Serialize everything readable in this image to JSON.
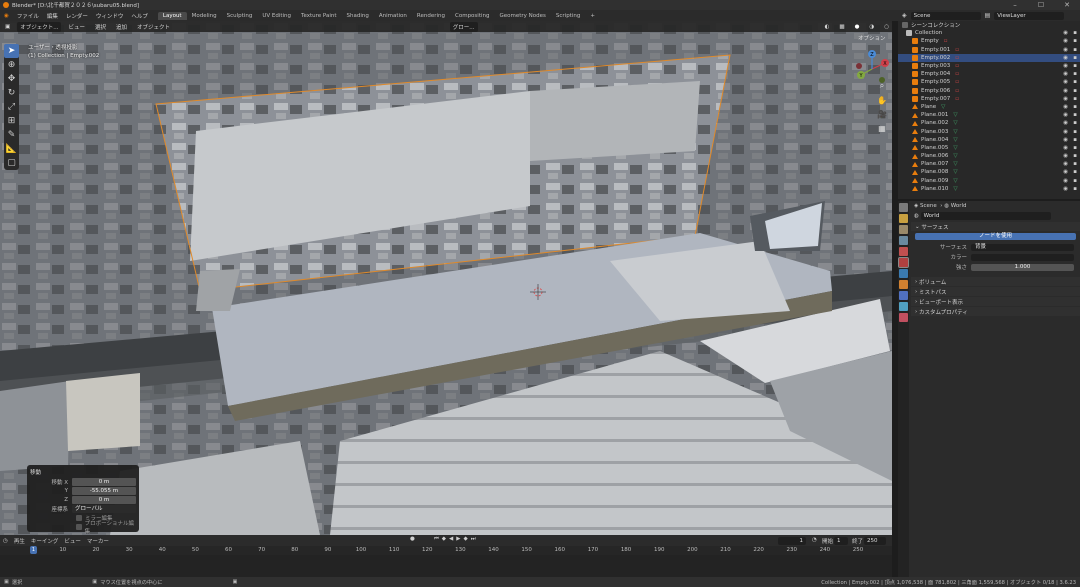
{
  "window": {
    "title": "Blender* [D:\\北千都賀２０２６\\subaru05.blend]"
  },
  "menu": [
    "ファイル",
    "編集",
    "レンダー",
    "ウィンドウ",
    "ヘルプ"
  ],
  "workspaces": [
    "Layout",
    "Modeling",
    "Sculpting",
    "UV Editing",
    "Texture Paint",
    "Shading",
    "Animation",
    "Rendering",
    "Compositing",
    "Geometry Nodes",
    "Scripting"
  ],
  "active_workspace": "Layout",
  "topright": {
    "scene": "Scene",
    "view_layer": "ViewLayer"
  },
  "viewport": {
    "mode": "オブジェクト...",
    "menus": [
      "ビュー",
      "選択",
      "追加",
      "オブジェクト"
    ],
    "orientation": "グロー...",
    "info_line1": "ユーザー・透視投影",
    "info_line2": "(1) Collection | Empty.002",
    "options_label": "オプション",
    "gizmo": {
      "x": "X",
      "y": "Y",
      "z": "Z"
    }
  },
  "operator_panel": {
    "title": "移動",
    "move_x_label": "移動 X",
    "move_x": "0 m",
    "y_label": "Y",
    "move_y": "-55.055 m",
    "z_label": "Z",
    "move_z": "0 m",
    "orientation_label": "座標系",
    "orientation": "グローバル",
    "mirror": "ミラー編集",
    "proportional": "プロポーショナル編集"
  },
  "timeline": {
    "menus": [
      "再生",
      "キーイング",
      "ビュー",
      "マーカー"
    ],
    "current_frame": "1",
    "start_label": "開始",
    "start": "1",
    "end_label": "終了",
    "end": "250",
    "ticks": [
      "1",
      "10",
      "20",
      "30",
      "40",
      "50",
      "60",
      "70",
      "80",
      "90",
      "100",
      "110",
      "120",
      "130",
      "140",
      "150",
      "160",
      "170",
      "180",
      "190",
      "200",
      "210",
      "220",
      "230",
      "240",
      "250"
    ]
  },
  "statusbar": {
    "left": "選択",
    "mid": "マウス位置を視点の中心に",
    "right": "Collection | Empty.002 | 頂点 1,076,538 | 面 781,802 | 三角面 1,559,568 | オブジェクト 0/18 | 3.6.23"
  },
  "outliner": {
    "root": "シーンコレクション",
    "collection": "Collection",
    "items": [
      {
        "name": "Empty",
        "type": "empty",
        "selected": false
      },
      {
        "name": "Empty.001",
        "type": "empty",
        "selected": false
      },
      {
        "name": "Empty.002",
        "type": "empty",
        "selected": true
      },
      {
        "name": "Empty.003",
        "type": "empty",
        "selected": false
      },
      {
        "name": "Empty.004",
        "type": "empty",
        "selected": false
      },
      {
        "name": "Empty.005",
        "type": "empty",
        "selected": false
      },
      {
        "name": "Empty.006",
        "type": "empty",
        "selected": false
      },
      {
        "name": "Empty.007",
        "type": "empty",
        "selected": false
      },
      {
        "name": "Plane",
        "type": "mesh",
        "selected": false
      },
      {
        "name": "Plane.001",
        "type": "mesh",
        "selected": false
      },
      {
        "name": "Plane.002",
        "type": "mesh",
        "selected": false
      },
      {
        "name": "Plane.003",
        "type": "mesh",
        "selected": false
      },
      {
        "name": "Plane.004",
        "type": "mesh",
        "selected": false
      },
      {
        "name": "Plane.005",
        "type": "mesh",
        "selected": false
      },
      {
        "name": "Plane.006",
        "type": "mesh",
        "selected": false
      },
      {
        "name": "Plane.007",
        "type": "mesh",
        "selected": false
      },
      {
        "name": "Plane.008",
        "type": "mesh",
        "selected": false
      },
      {
        "name": "Plane.009",
        "type": "mesh",
        "selected": false
      },
      {
        "name": "Plane.010",
        "type": "mesh",
        "selected": false
      }
    ]
  },
  "properties": {
    "breadcrumb_scene": "Scene",
    "breadcrumb_world": "World",
    "world_name": "World",
    "surface_section": "サーフェス",
    "use_nodes_button": "ノードを使用",
    "surface_label": "サーフェス",
    "surface_value": "背景",
    "color_label": "カラー",
    "strength_label": "強さ",
    "strength_value": "1.000",
    "sections": [
      "ボリューム",
      "ミストパス",
      "ビューポート表示",
      "カスタムプロパティ"
    ]
  },
  "colors": {
    "accent": "#4772b3",
    "selection": "#334d80",
    "empty_icon": "#e87d0d",
    "mesh_icon": "#e87d0d",
    "vertex_group": "#42a86b"
  }
}
